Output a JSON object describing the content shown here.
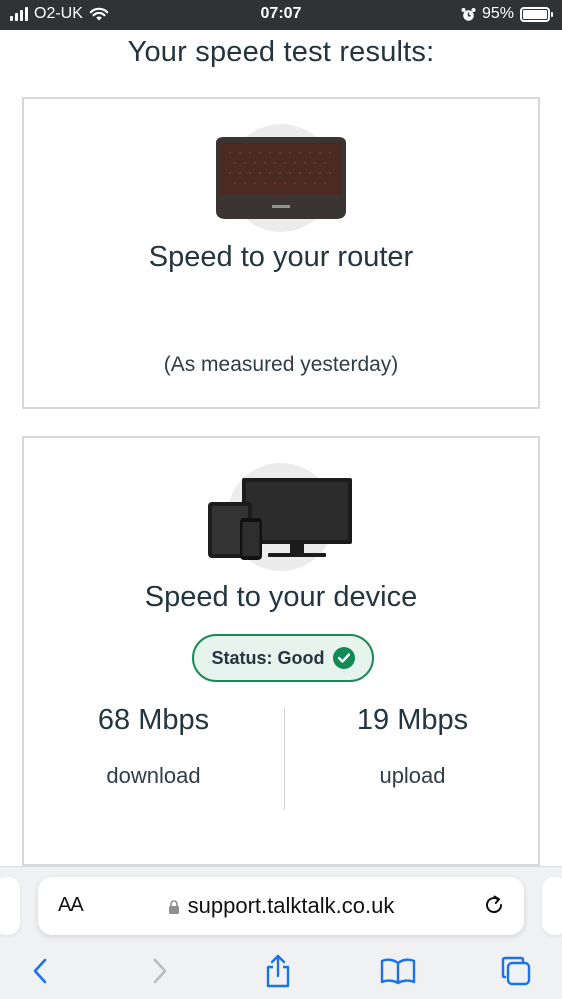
{
  "status_bar": {
    "carrier": "O2-UK",
    "time": "07:07",
    "battery": "95%",
    "battery_level": 0.95
  },
  "page": {
    "title": "Your speed test results:"
  },
  "router_card": {
    "title": "Speed to your router",
    "measured": "(As measured yesterday)",
    "image_icon": "router-icon"
  },
  "device_card": {
    "title": "Speed to your device",
    "status": "Status: Good",
    "status_icon": "check-circle-icon",
    "image_icon": "devices-icon",
    "download_value": "68 Mbps",
    "download_label": "download",
    "upload_value": "19 Mbps",
    "upload_label": "upload",
    "status_color": "#118a54"
  },
  "browser": {
    "text_size_label": "AA",
    "url": "support.talktalk.co.uk",
    "icons": [
      "lock-icon",
      "reload-icon",
      "back-icon",
      "forward-icon",
      "share-icon",
      "bookmarks-icon",
      "tabs-icon"
    ]
  }
}
